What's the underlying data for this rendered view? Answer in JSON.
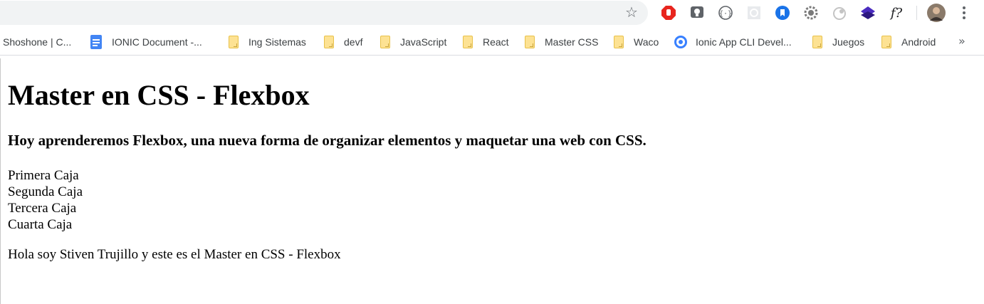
{
  "browser": {
    "bookmarks": [
      {
        "label": "Shoshone | C...",
        "icon": "none"
      },
      {
        "label": "IONIC Document -...",
        "icon": "google-docs-icon"
      },
      {
        "label": "Ing Sistemas",
        "icon": "folder-icon"
      },
      {
        "label": "devf",
        "icon": "folder-icon"
      },
      {
        "label": "JavaScript",
        "icon": "folder-icon"
      },
      {
        "label": "React",
        "icon": "folder-icon"
      },
      {
        "label": "Master CSS",
        "icon": "folder-icon"
      },
      {
        "label": "Waco",
        "icon": "folder-icon"
      },
      {
        "label": "Ionic App CLI Devel...",
        "icon": "ionic-icon"
      },
      {
        "label": "Juegos",
        "icon": "folder-icon"
      },
      {
        "label": "Android",
        "icon": "folder-icon"
      }
    ],
    "overflow_chevron": "»",
    "font_ext_label": "f?",
    "extensions": [
      "adblock-icon",
      "tab-extension-icon",
      "code-icon",
      "grid-icon",
      "bookmark-ext-icon",
      "gear-ext-icon",
      "timer-icon",
      "layers-icon",
      "font-ext-icon"
    ]
  },
  "page": {
    "title": "Master en CSS - Flexbox",
    "subtitle": "Hoy aprenderemos Flexbox, una nueva forma de organizar elementos y maquetar una web con CSS.",
    "boxes": [
      "Primera Caja",
      "Segunda Caja",
      "Tercera Caja",
      "Cuarta Caja"
    ],
    "footer": "Hola soy Stiven Trujillo y este es el Master en CSS - Flexbox"
  }
}
